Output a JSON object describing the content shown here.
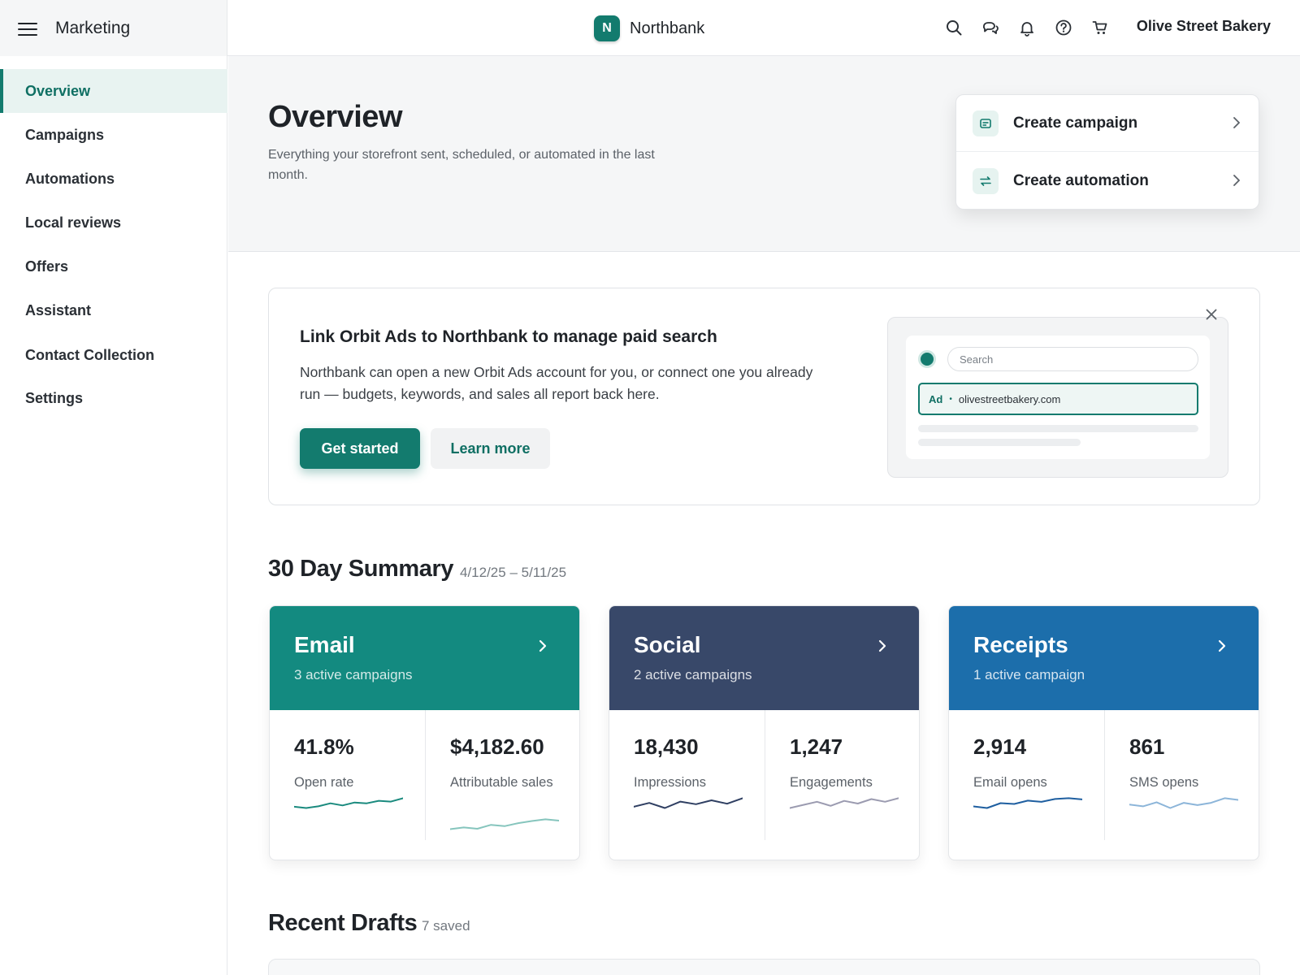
{
  "topbar": {
    "app_name": "Marketing",
    "brand_letter": "N",
    "brand_name": "Northbank",
    "merchant_name": "Olive Street Bakery",
    "icons": [
      "search-icon",
      "chat-icon",
      "bell-icon",
      "help-icon",
      "cart-icon"
    ]
  },
  "sidebar": {
    "items": [
      {
        "label": "Overview",
        "active": true
      },
      {
        "label": "Campaigns"
      },
      {
        "label": "Automations"
      },
      {
        "label": "Local reviews"
      },
      {
        "label": "Offers"
      },
      {
        "label": "Assistant"
      },
      {
        "label": "Contact Collection"
      },
      {
        "label": "Settings"
      }
    ]
  },
  "hero": {
    "title": "Overview",
    "subtitle": "Everything your storefront sent, scheduled, or automated in the last month."
  },
  "quick_actions": {
    "create_campaign": "Create campaign",
    "create_automation": "Create automation"
  },
  "promo": {
    "title": "Link Orbit Ads to Northbank to manage paid search",
    "body": "Northbank can open a new Orbit Ads account for you, or connect one you already run — budgets, keywords, and sales all report back here.",
    "primary_label": "Get started",
    "secondary_label": "Learn more",
    "preview": {
      "search_placeholder": "Search",
      "ad_tag": "Ad",
      "ad_separator": "•",
      "ad_url": "olivestreetbakery.com"
    }
  },
  "summary": {
    "title": "30 Day Summary",
    "range": "4/12/25 – 5/11/25",
    "cards": [
      {
        "title": "Email",
        "subtitle": "3 active campaigns",
        "color": "#138a80",
        "metrics": [
          {
            "value": "41.8%",
            "label": "Open rate",
            "trend": [
              4,
              4.6,
              3.8,
              2.4,
              3.4,
              2.0,
              2.4,
              1.2,
              1.6,
              0
            ],
            "color": "#1a8a7e"
          },
          {
            "value": "$4,182.60",
            "label": "Attributable sales",
            "trend": [
              4.6,
              3.8,
              4.4,
              2.6,
              3.2,
              1.8,
              0.8,
              0,
              0.6
            ],
            "color": "#86c5bd"
          }
        ]
      },
      {
        "title": "Social",
        "subtitle": "2 active campaigns",
        "color": "#384869",
        "metrics": [
          {
            "value": "18,430",
            "label": "Impressions",
            "trend": [
              4,
              2.2,
              4.6,
              1.6,
              2.8,
              1.0,
              2.6,
              0
            ],
            "color": "#2f3f62"
          },
          {
            "value": "1,247",
            "label": "Engagements",
            "trend": [
              4.4,
              3.0,
              1.6,
              3.4,
              1.2,
              2.4,
              0.4,
              1.6,
              0
            ],
            "color": "#9b9bb0"
          }
        ]
      },
      {
        "title": "Receipts",
        "subtitle": "1 active campaign",
        "color": "#1c6eab",
        "metrics": [
          {
            "value": "2,914",
            "label": "Email opens",
            "trend": [
              4,
              4.8,
              2.4,
              2.8,
              1.2,
              1.8,
              0.4,
              0,
              0.6
            ],
            "color": "#1f5fa0"
          },
          {
            "value": "861",
            "label": "SMS opens",
            "trend": [
              2.2,
              2.8,
              1.4,
              3.4,
              1.6,
              2.4,
              1.6,
              0,
              0.6
            ],
            "color": "#8cb5d9"
          }
        ]
      }
    ]
  },
  "drafts": {
    "title": "Recent Drafts",
    "count_label": "7 saved"
  }
}
